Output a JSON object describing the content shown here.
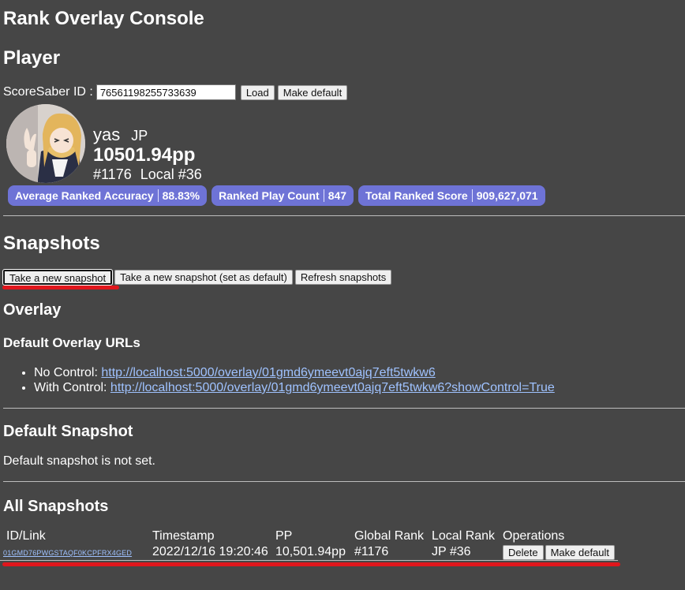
{
  "page": {
    "title": "Rank Overlay Console"
  },
  "player": {
    "heading": "Player",
    "id_label": "ScoreSaber ID :",
    "id_value": "76561198255733639",
    "load_label": "Load",
    "make_default_label": "Make default",
    "name": "yas",
    "country": "JP",
    "pp": "10501.94pp",
    "global_rank": "#1176",
    "local_rank": "Local #36",
    "stats": [
      {
        "label": "Average Ranked Accuracy",
        "value": "88.83%"
      },
      {
        "label": "Ranked Play Count",
        "value": "847"
      },
      {
        "label": "Total Ranked Score",
        "value": "909,627,071"
      }
    ]
  },
  "snapshots": {
    "heading": "Snapshots",
    "take_label": "Take a new snapshot",
    "take_default_label": "Take a new snapshot (set as default)",
    "refresh_label": "Refresh snapshots"
  },
  "overlay": {
    "heading": "Overlay",
    "urls_heading": "Default Overlay URLs",
    "items": [
      {
        "label": "No Control:",
        "url": "http://localhost:5000/overlay/01gmd6ymeevt0ajq7eft5twkw6"
      },
      {
        "label": "With Control:",
        "url": "http://localhost:5000/overlay/01gmd6ymeevt0ajq7eft5twkw6?showControl=True"
      }
    ]
  },
  "default_snapshot": {
    "heading": "Default Snapshot",
    "text": "Default snapshot is not set."
  },
  "all_snapshots": {
    "heading": "All Snapshots",
    "columns": [
      "ID/Link",
      "Timestamp",
      "PP",
      "Global Rank",
      "Local Rank",
      "Operations"
    ],
    "rows": [
      {
        "id": "01GMD76PWGSTAQF0KCPFRX4GED",
        "timestamp": "2022/12/16 19:20:46",
        "pp": "10,501.94pp",
        "global_rank": "#1176",
        "local_rank": "JP #36",
        "delete_label": "Delete",
        "make_default_label": "Make default"
      }
    ]
  },
  "colors": {
    "background": "#464646",
    "badge": "#6e73d6",
    "link": "#9fc2ff",
    "highlight": "#e0161c"
  }
}
